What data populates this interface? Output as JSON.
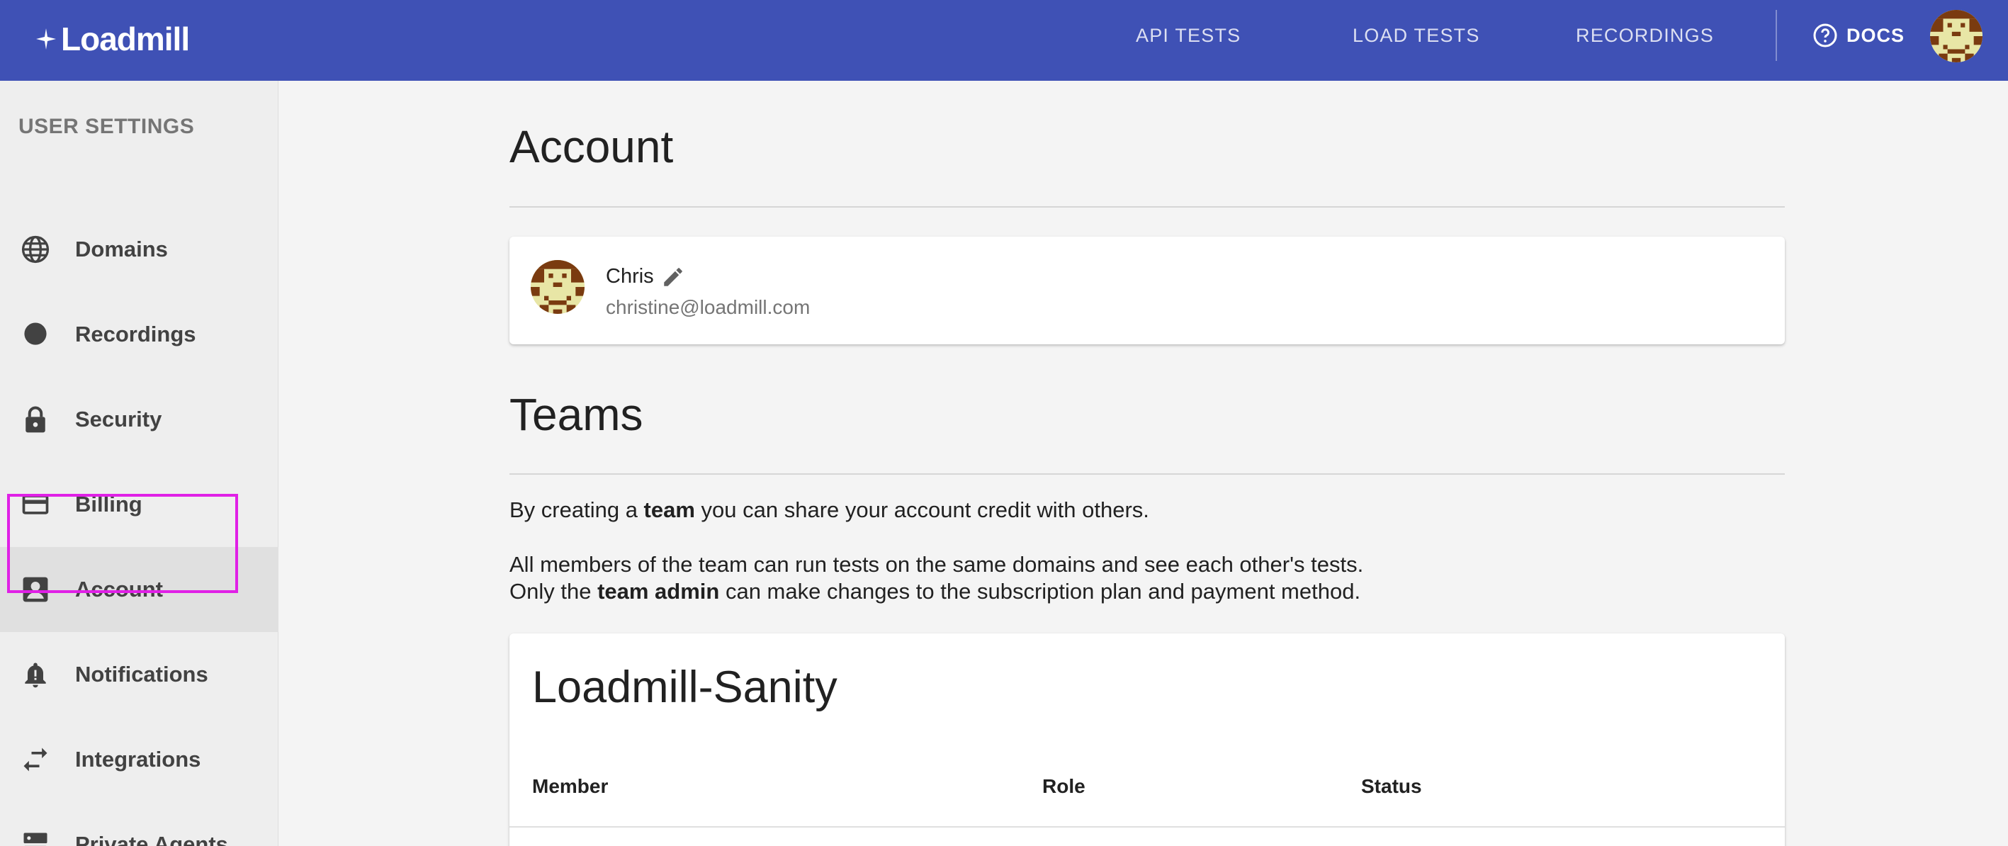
{
  "topbar": {
    "logo": "Loadmill",
    "nav": [
      "API TESTS",
      "LOAD TESTS",
      "RECORDINGS"
    ],
    "docs": "DOCS",
    "icons": {
      "docs": "help-circle-icon",
      "avatar": "pixel-avatar"
    }
  },
  "sidebar": {
    "title": "USER SETTINGS",
    "items": [
      {
        "label": "Domains",
        "icon": "globe-icon"
      },
      {
        "label": "Recordings",
        "icon": "record-dot-icon"
      },
      {
        "label": "Security",
        "icon": "lock-icon"
      },
      {
        "label": "Billing",
        "icon": "credit-card-icon"
      },
      {
        "label": "Account",
        "icon": "account-box-icon",
        "active": true
      },
      {
        "label": "Notifications",
        "icon": "bell-icon"
      },
      {
        "label": "Integrations",
        "icon": "swap-arrows-icon"
      },
      {
        "label": "Private Agents",
        "icon": "server-icon"
      }
    ]
  },
  "account": {
    "title": "Account",
    "user": {
      "name": "Chris",
      "email": "christine@loadmill.com"
    }
  },
  "teams": {
    "title": "Teams",
    "p1_before": "By creating a ",
    "p1_bold": "team",
    "p1_after": " you can share your account credit with others.",
    "p2": "All members of the team can run tests on the same domains and see each other's tests.",
    "p3_before": "Only the ",
    "p3_bold": "team admin",
    "p3_after": " can make changes to the subscription plan and payment method.",
    "team": {
      "name": "Loadmill-Sanity",
      "columns": [
        "Member",
        "Role",
        "Status"
      ]
    }
  },
  "colors": {
    "topbar": "#3f51b5",
    "highlight": "#e020e6",
    "sidebar": "#eeeeee",
    "background": "#f4f4f4"
  }
}
